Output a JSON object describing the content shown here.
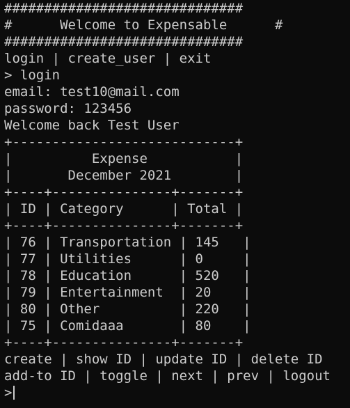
{
  "terminal": {
    "banner": [
      "##############################",
      "#      Welcome to Expensable      #",
      "##############################"
    ],
    "main_menu": "login | create_user | exit",
    "command": "> login",
    "email_line": "email: test10@mail.com",
    "password_line": "password: 123456",
    "welcome_line": "Welcome back Test User",
    "table": {
      "top_border": "+----------------------------+",
      "title_line": "|          Expense           |",
      "subtitle_line": "|       December 2021        |",
      "header_border": "+----+---------------+-------+",
      "header_line": "| ID | Category      | Total |",
      "rows_border": "+----+---------------+-------+",
      "rows": [
        "| 76 | Transportation | 145   |",
        "| 77 | Utilities      | 0     |",
        "| 78 | Education      | 520   |",
        "| 79 | Entertainment  | 20    |",
        "| 80 | Other          | 220   |",
        "| 75 | Comidaaa       | 80    |"
      ],
      "bottom_border": "+----+---------------+-------+"
    },
    "action_menu_1": "create | show ID | update ID | delete ID",
    "action_menu_2": "add-to ID | toggle | next | prev | logout",
    "prompt": ">"
  }
}
